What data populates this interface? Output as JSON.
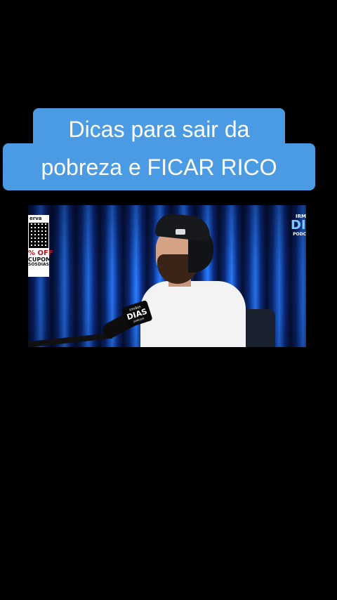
{
  "caption": {
    "line1": "Dicas para sair da",
    "line2": "pobreza e FICAR RICO"
  },
  "video": {
    "promo": {
      "brand": "erva",
      "discount": "% OFF",
      "coupon_label": "CUPOM",
      "coupon_code": "SOSDIAS"
    },
    "podcast_logo": {
      "top": "IRM",
      "middle": "DIA",
      "bottom": "PODC"
    },
    "mic_tag": {
      "top": "irmãos",
      "middle": "DIAS",
      "bottom": "podcast"
    }
  },
  "colors": {
    "caption_bg": "#4a9be3",
    "background": "#000000",
    "curtain_blue": "#2a7dff"
  }
}
